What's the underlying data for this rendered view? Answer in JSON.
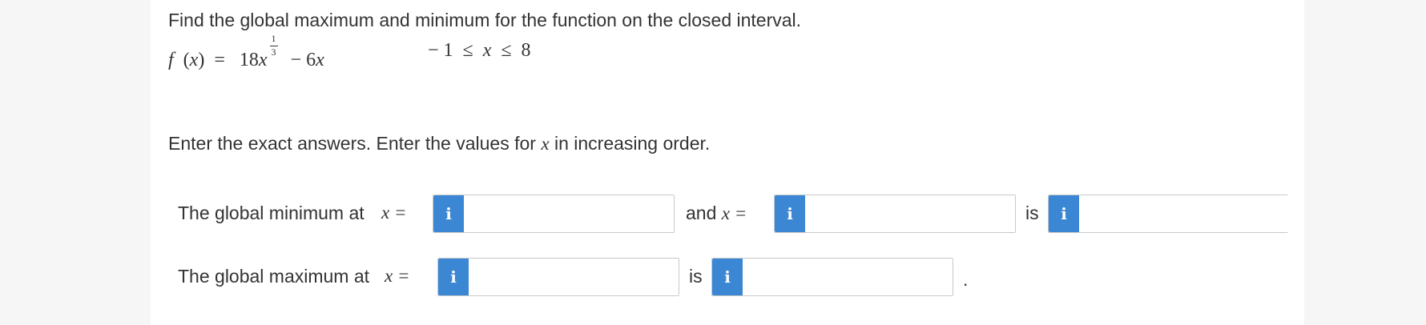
{
  "question": {
    "prompt": "Find the global maximum and minimum for the function on the closed interval.",
    "function": {
      "name": "f",
      "variable": "x",
      "coefficient_1": "18",
      "exponent_numerator": "1",
      "exponent_denominator": "3",
      "operator": "−",
      "term_2": "6",
      "interval_lower": "− 1",
      "interval_upper": "8",
      "interval_relation": "≤"
    },
    "instructions_prefix": "Enter the exact answers. Enter the values for ",
    "instructions_var": "x",
    "instructions_suffix": " in increasing order."
  },
  "minimum_row": {
    "label": "The global minimum at",
    "x_equals": "x =",
    "and_label": "and",
    "and_x_equals": "x =",
    "is_label": "is",
    "x1_value": "",
    "x2_value": "",
    "value": ""
  },
  "maximum_row": {
    "label": "The global maximum at",
    "x_equals": "x =",
    "is_label": "is",
    "x_value": "",
    "value": "",
    "period": "."
  },
  "info_icon": {
    "glyph": "i",
    "name": "info-icon",
    "color": "#3b87d4"
  }
}
